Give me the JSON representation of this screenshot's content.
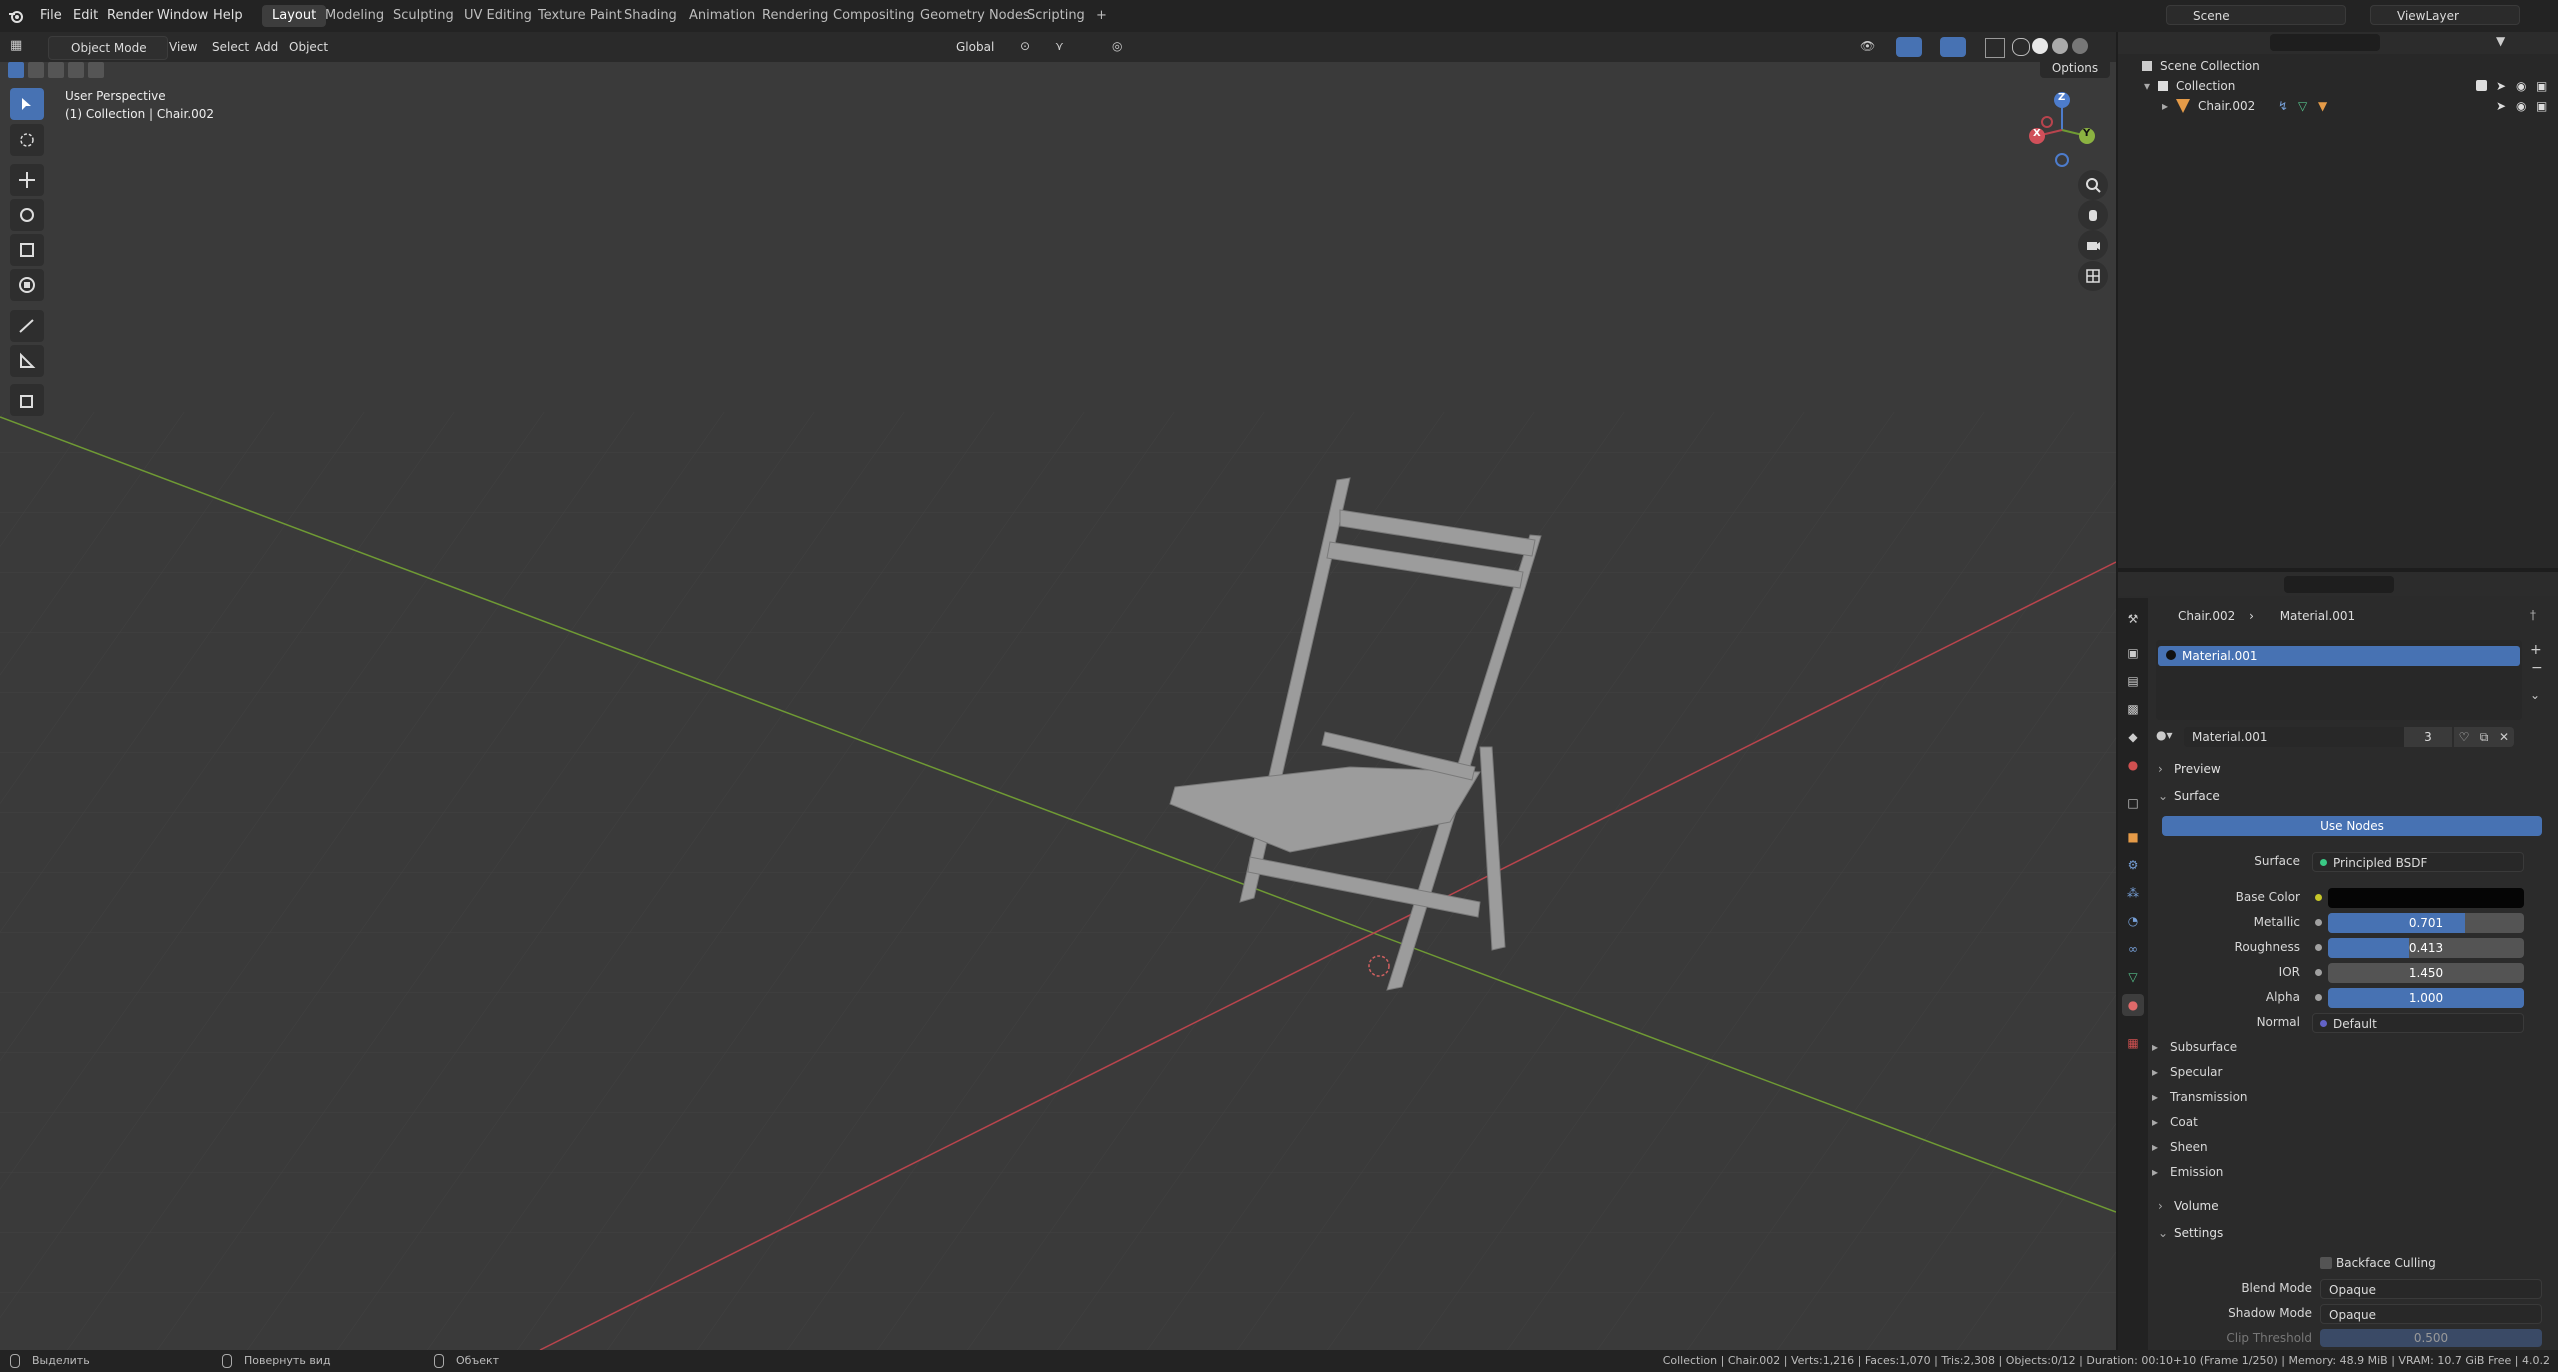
{
  "topbar": {
    "menus": [
      "File",
      "Edit",
      "Render",
      "Window",
      "Help"
    ],
    "workspaces": [
      "Layout",
      "Modeling",
      "Sculpting",
      "UV Editing",
      "Texture Paint",
      "Shading",
      "Animation",
      "Rendering",
      "Compositing",
      "Geometry Nodes",
      "Scripting"
    ],
    "active_workspace": "Layout",
    "add_tab": "+",
    "scene": "Scene",
    "view_layer": "ViewLayer"
  },
  "viewport": {
    "mode": "Object Mode",
    "menus": [
      "View",
      "Select",
      "Add",
      "Object"
    ],
    "orientation": "Global",
    "options": "Options",
    "overlay_title": "User Perspective",
    "overlay_sub": "(1) Collection | Chair.002",
    "gizmo": {
      "x": "X",
      "y": "Y",
      "z": "Z"
    },
    "colors": {
      "bg": "#3a3a3a",
      "grid": "#464646",
      "x_axis": "#b8444d",
      "y_axis": "#6f9a34",
      "chair": "#9c9c9c",
      "active_tool": "#4772b3"
    }
  },
  "outliner": {
    "scene_collection": "Scene Collection",
    "collection": "Collection",
    "object": "Chair.002"
  },
  "properties": {
    "breadcrumb_object": "Chair.002",
    "breadcrumb_material": "Material.001",
    "slot_name": "Material.001",
    "material_name": "Material.001",
    "user_count": "3",
    "preview": "Preview",
    "surface_panel": "Surface",
    "use_nodes": "Use Nodes",
    "surface_label": "Surface",
    "surface_value": "Principled BSDF",
    "base_color_label": "Base Color",
    "base_color": "#050505",
    "metallic_label": "Metallic",
    "metallic": "0.701",
    "metallic_fraction": 0.701,
    "roughness_label": "Roughness",
    "roughness": "0.413",
    "roughness_fraction": 0.413,
    "ior_label": "IOR",
    "ior": "1.450",
    "alpha_label": "Alpha",
    "alpha": "1.000",
    "alpha_fraction": 1.0,
    "normal_label": "Normal",
    "normal_value": "Default",
    "subpanels": [
      "Subsurface",
      "Specular",
      "Transmission",
      "Coat",
      "Sheen",
      "Emission"
    ],
    "volume": "Volume",
    "settings": "Settings",
    "backface_culling": "Backface Culling",
    "blend_mode_label": "Blend Mode",
    "blend_mode": "Opaque",
    "shadow_mode_label": "Shadow Mode",
    "shadow_mode": "Opaque",
    "clip_threshold_label": "Clip Threshold",
    "clip_threshold": "0.500"
  },
  "status": {
    "hint1": "Выделить",
    "hint2": "Повернуть вид",
    "hint3": "Объект",
    "info": "Collection | Chair.002 | Verts:1,216 | Faces:1,070 | Tris:2,308 | Objects:0/12 | Duration: 00:10+10 (Frame 1/250) | Memory: 48.9 MiB | VRAM: 10.7 GiB Free | 4.0.2"
  }
}
